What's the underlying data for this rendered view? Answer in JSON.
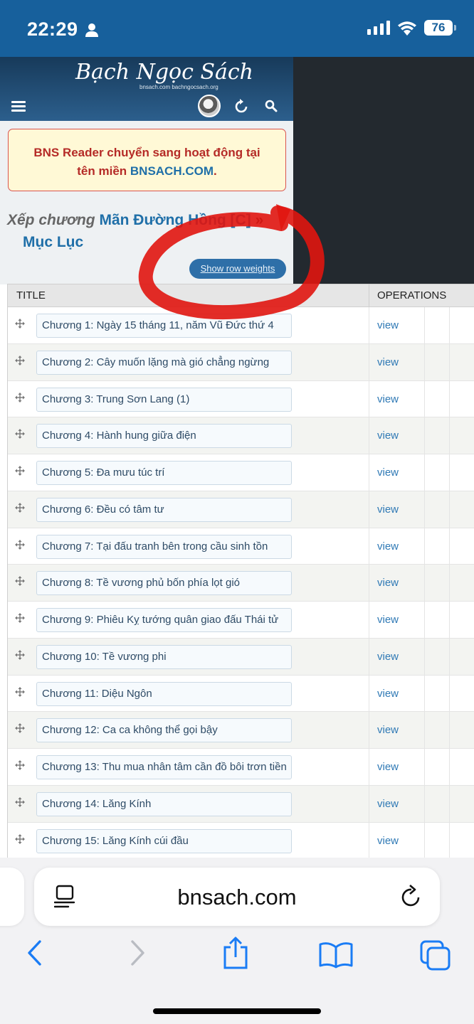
{
  "status_bar": {
    "time": "22:29",
    "battery": "76"
  },
  "site": {
    "logo": "Bạch Ngọc Sách",
    "logo_sub": "bnsach.com bachngocsach.org"
  },
  "notice": {
    "line1": "BNS Reader chuyển sang hoạt động tại",
    "line2_prefix": "tên miền ",
    "line2_link": "BNSACH.COM",
    "line2_suffix": "."
  },
  "heading": {
    "prefix": "Xếp chương",
    "story": "Mãn Đường Hồng [C]",
    "separator": "»",
    "toc": "Mục Lục"
  },
  "row_weights_button": "Show row weights",
  "table": {
    "col_title": "TITLE",
    "col_ops": "OPERATIONS",
    "view_label": "view",
    "rows": [
      "Chương 1: Ngày 15 tháng 11, năm Vũ Đức thứ 4",
      "Chương 2: Cây muốn lặng mà gió chẳng ngừng",
      "Chương 3: Trung Sơn Lang (1)",
      "Chương 4: Hành hung giữa điện",
      "Chương 5: Đa mưu túc trí",
      "Chương 6: Đều có tâm tư",
      "Chương 7: Tại đấu tranh bên trong cầu sinh tồn",
      "Chương 8: Tề vương phủ bốn phía lọt gió",
      "Chương 9: Phiêu Kỵ tướng quân giao đấu Thái tử",
      "Chương 10: Tề vương phi",
      "Chương 11: Diệu Ngôn",
      "Chương 12: Ca ca không thể gọi bậy",
      "Chương 13: Thu mua nhân tâm cần đồ bôi trơn tiền",
      "Chương 14: Lăng Kính",
      "Chương 15: Lăng Kính cúi đầu"
    ]
  },
  "browser": {
    "url": "bnsach.com"
  },
  "colors": {
    "status_bar": "#17609c",
    "link": "#1f6fa8",
    "marker": "#e0150f"
  }
}
